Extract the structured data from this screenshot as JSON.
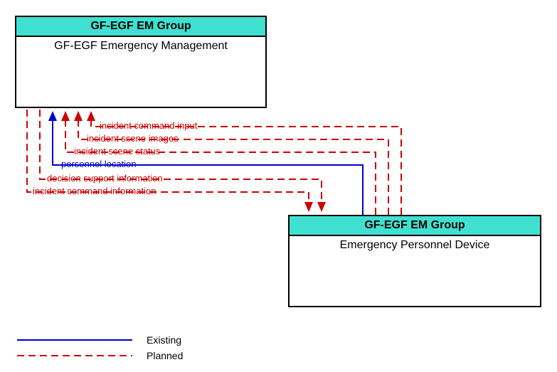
{
  "nodes": {
    "top": {
      "header": "GF-EGF EM Group",
      "body": "GF-EGF Emergency Management"
    },
    "bottom": {
      "header": "GF-EGF EM Group",
      "body": "Emergency Personnel Device"
    }
  },
  "flows": {
    "f1": "incident command input",
    "f2": "incident scene images",
    "f3": "incident scene status",
    "f4": "personnel location",
    "f5": "decision support information",
    "f6": "incident command information"
  },
  "legend": {
    "existing": "Existing",
    "planned": "Planned"
  },
  "colors": {
    "existing": "#0000cc",
    "planned": "#cc0000",
    "nodeHeader": "#40e0d0"
  },
  "chart_data": {
    "type": "diagram",
    "nodes": [
      {
        "id": "gf_egf_em",
        "group": "GF-EGF EM Group",
        "label": "GF-EGF Emergency Management"
      },
      {
        "id": "epd",
        "group": "GF-EGF EM Group",
        "label": "Emergency Personnel Device"
      }
    ],
    "edges": [
      {
        "from": "epd",
        "to": "gf_egf_em",
        "label": "incident command input",
        "status": "planned"
      },
      {
        "from": "epd",
        "to": "gf_egf_em",
        "label": "incident scene images",
        "status": "planned"
      },
      {
        "from": "epd",
        "to": "gf_egf_em",
        "label": "incident scene status",
        "status": "planned"
      },
      {
        "from": "epd",
        "to": "gf_egf_em",
        "label": "personnel location",
        "status": "existing"
      },
      {
        "from": "gf_egf_em",
        "to": "epd",
        "label": "decision support information",
        "status": "planned"
      },
      {
        "from": "gf_egf_em",
        "to": "epd",
        "label": "incident command information",
        "status": "planned"
      }
    ],
    "legend": {
      "existing": "solid blue",
      "planned": "dashed red"
    }
  }
}
